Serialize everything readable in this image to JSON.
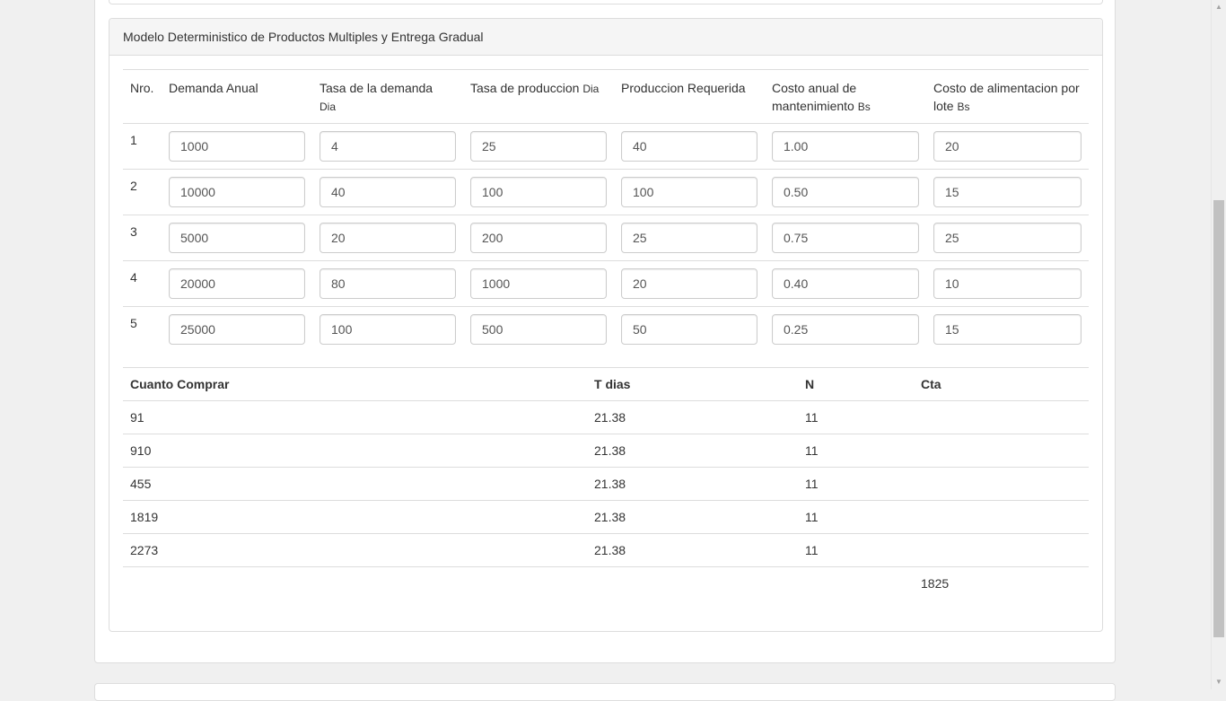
{
  "panel": {
    "title": "Modelo Deterministico de Productos Multiples y Entrega Gradual"
  },
  "input_table": {
    "headers": {
      "nro": "Nro.",
      "demanda": "Demanda Anual",
      "tasa_demanda": "Tasa de la demanda",
      "tasa_demanda_unit": "Dia",
      "tasa_produccion": "Tasa de produccion",
      "tasa_produccion_unit": "Dia",
      "produccion": "Produccion Requerida",
      "costo_mant": "Costo anual de mantenimiento",
      "costo_mant_unit": "Bs",
      "costo_alim": "Costo de alimentacion por lote",
      "costo_alim_unit": "Bs"
    },
    "rows": [
      {
        "nro": "1",
        "demanda": "1000",
        "tasa_demanda": "4",
        "tasa_produccion": "25",
        "produccion": "40",
        "costo_mant": "1.00",
        "costo_alim": "20"
      },
      {
        "nro": "2",
        "demanda": "10000",
        "tasa_demanda": "40",
        "tasa_produccion": "100",
        "produccion": "100",
        "costo_mant": "0.50",
        "costo_alim": "15"
      },
      {
        "nro": "3",
        "demanda": "5000",
        "tasa_demanda": "20",
        "tasa_produccion": "200",
        "produccion": "25",
        "costo_mant": "0.75",
        "costo_alim": "25"
      },
      {
        "nro": "4",
        "demanda": "20000",
        "tasa_demanda": "80",
        "tasa_produccion": "1000",
        "produccion": "20",
        "costo_mant": "0.40",
        "costo_alim": "10"
      },
      {
        "nro": "5",
        "demanda": "25000",
        "tasa_demanda": "100",
        "tasa_produccion": "500",
        "produccion": "50",
        "costo_mant": "0.25",
        "costo_alim": "15"
      }
    ]
  },
  "result_table": {
    "headers": {
      "cuanto": "Cuanto Comprar",
      "t_dias": "T dias",
      "n": "N",
      "cta": "Cta"
    },
    "rows": [
      {
        "cuanto": "91",
        "t_dias": "21.38",
        "n": "11",
        "cta": ""
      },
      {
        "cuanto": "910",
        "t_dias": "21.38",
        "n": "11",
        "cta": ""
      },
      {
        "cuanto": "455",
        "t_dias": "21.38",
        "n": "11",
        "cta": ""
      },
      {
        "cuanto": "1819",
        "t_dias": "21.38",
        "n": "11",
        "cta": ""
      },
      {
        "cuanto": "2273",
        "t_dias": "21.38",
        "n": "11",
        "cta": ""
      }
    ],
    "total_cta": "1825"
  }
}
